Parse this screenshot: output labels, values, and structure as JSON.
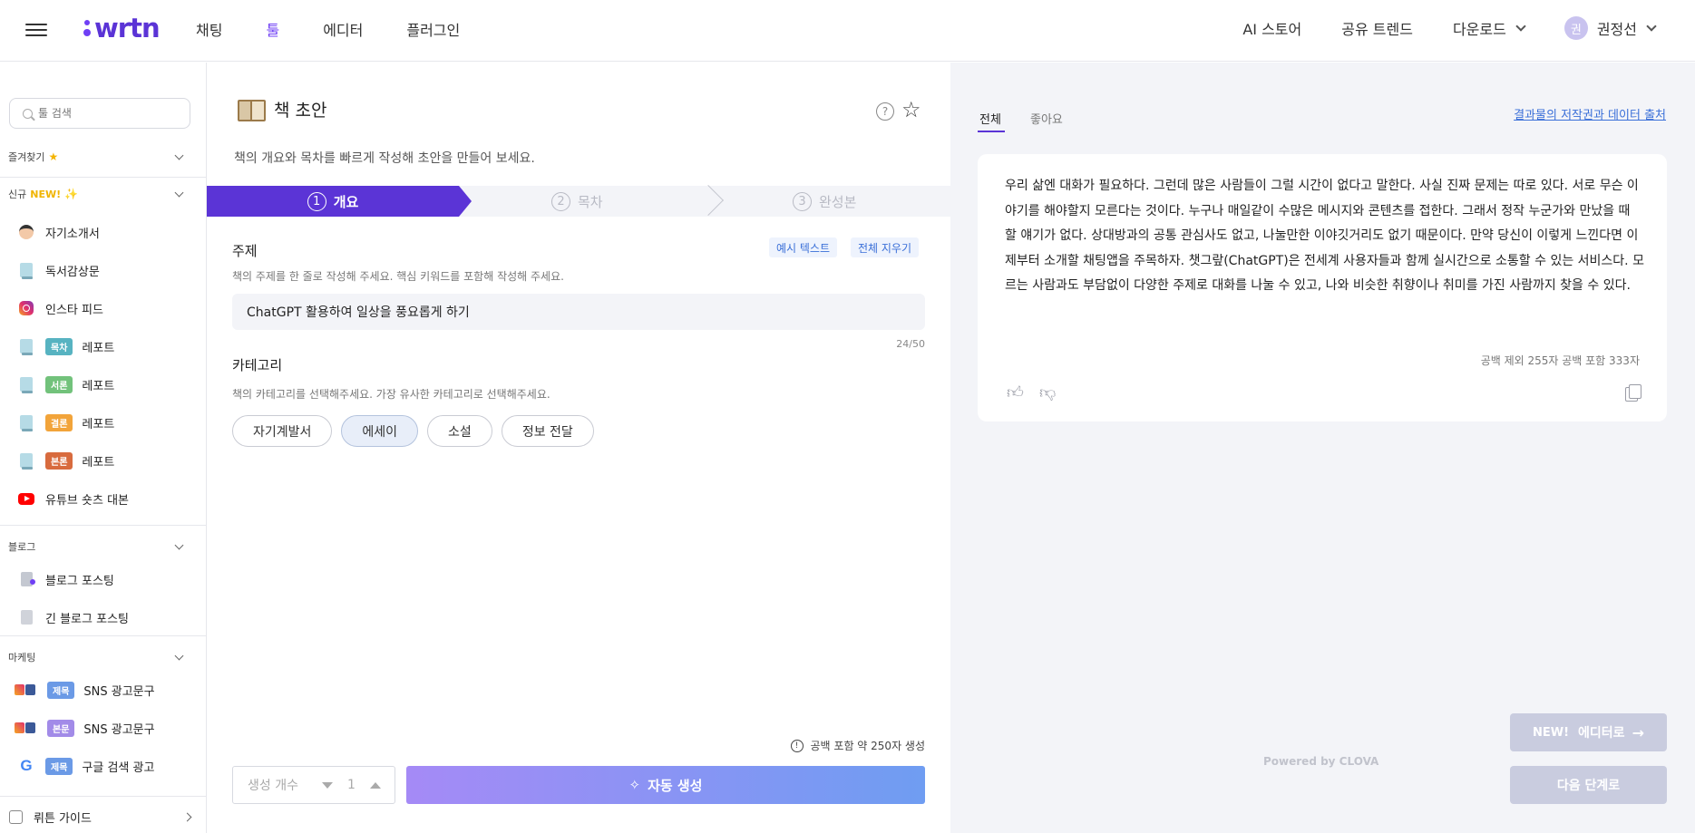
{
  "nav": {
    "logo": "wrtn",
    "main": [
      "채팅",
      "툴",
      "에디터",
      "플러그인"
    ],
    "active_index": 1,
    "right": {
      "store": "AI 스토어",
      "trend": "공유 트렌드",
      "download": "다운로드",
      "avatar_initial": "권",
      "user": "권정선"
    }
  },
  "sidebar": {
    "search_placeholder": "툴 검색",
    "favorites": "즐겨찾기",
    "new_section": "신규",
    "new_badge": "NEW!",
    "new_items": [
      {
        "tag": "",
        "label": "자기소개서",
        "icon": "person-icon"
      },
      {
        "tag": "",
        "label": "독서감상문",
        "icon": "book-icon"
      },
      {
        "tag": "",
        "label": "인스타 피드",
        "icon": "instagram-icon"
      },
      {
        "tag": "목차",
        "label": "레포트",
        "icon": "book-icon"
      },
      {
        "tag": "서론",
        "label": "레포트",
        "icon": "book-icon"
      },
      {
        "tag": "결론",
        "label": "레포트",
        "icon": "book-icon"
      },
      {
        "tag": "본론",
        "label": "레포트",
        "icon": "book-icon"
      },
      {
        "tag": "",
        "label": "유튜브 숏츠 대본",
        "icon": "youtube-icon"
      }
    ],
    "blog_section": "블로그",
    "blog_items": [
      "블로그 포스팅",
      "긴 블로그 포스팅"
    ],
    "marketing_section": "마케팅",
    "marketing_items": [
      {
        "tag": "제목",
        "label": "SNS 광고문구"
      },
      {
        "tag": "본문",
        "label": "SNS 광고문구"
      },
      {
        "tag": "제목",
        "label": "구글 검색 광고"
      }
    ],
    "guide": "뤼튼 가이드"
  },
  "tool": {
    "title": "책 초안",
    "description": "책의 개요와 목차를 빠르게 작성해 초안을 만들어 보세요.",
    "steps": [
      {
        "num": "1",
        "label": "개요"
      },
      {
        "num": "2",
        "label": "목차"
      },
      {
        "num": "3",
        "label": "완성본"
      }
    ],
    "topic": {
      "label": "주제",
      "help": "책의 주제를 한 줄로 작성해 주세요. 핵심 키워드를 포함해 작성해 주세요.",
      "value": "ChatGPT 활용하여 일상을 풍요롭게 하기",
      "counter": "24/50",
      "example_btn": "예시 텍스트",
      "clear_btn": "전체 지우기"
    },
    "category": {
      "label": "카테고리",
      "help": "책의 카테고리를 선택해주세요. 가장 유사한 카테고리로 선택해주세요.",
      "options": [
        "자기계발서",
        "에세이",
        "소설",
        "정보 전달"
      ],
      "selected_index": 1
    },
    "gen_note": "공백 포함 약 250자 생성",
    "count_label": "생성 개수",
    "count_value": "1",
    "generate_btn": "자동 생성"
  },
  "result": {
    "tabs": [
      "전체",
      "좋아요"
    ],
    "copyright_link": "결과물의 저작권과 데이터 출처",
    "text": "우리 삶엔 대화가 필요하다. 그런데 많은 사람들이 그럴 시간이 없다고 말한다. 사실 진짜 문제는 따로 있다. 서로 무슨 이야기를 해야할지 모른다는 것이다. 누구나 매일같이 수많은 메시지와 콘텐츠를 접한다. 그래서 정작 누군가와 만났을 때 할 얘기가 없다. 상대방과의 공통 관심사도 없고, 나눌만한 이야깃거리도 없기 때문이다. 만약 당신이 이렇게 느낀다면 이제부터 소개할 채팅앱을 주목하자. 챗그랖(ChatGPT)은 전세계 사용자들과 함께 실시간으로 소통할 수 있는 서비스다. 모르는 사람과도 부담없이 다양한 주제로 대화를 나눌 수 있고, 나와 비슷한 취향이나 취미를 가진 사람까지 찾을 수 있다.",
    "stats": "공백 제외 255자   공백 포함 333자",
    "powered": "Powered by CLOVA",
    "editor_badge": "NEW!",
    "editor_btn": "에디터로",
    "next_btn": "다음 단계로"
  }
}
